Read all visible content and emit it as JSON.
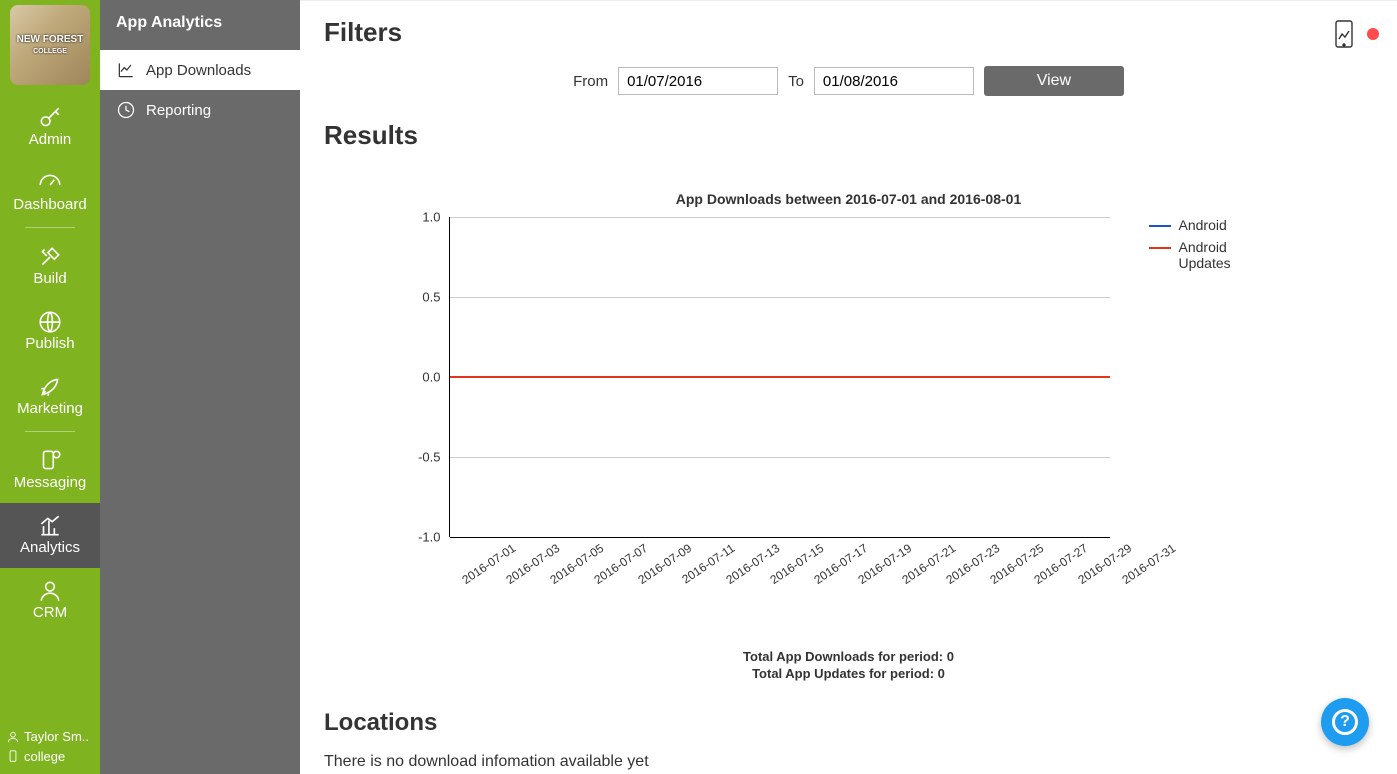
{
  "logo_text": "NEW FOREST",
  "logo_sub": "COLLEGE",
  "main_nav": {
    "items": [
      {
        "label": "Admin"
      },
      {
        "label": "Dashboard"
      },
      {
        "label": "Build"
      },
      {
        "label": "Publish"
      },
      {
        "label": "Marketing"
      },
      {
        "label": "Messaging"
      },
      {
        "label": "Analytics"
      },
      {
        "label": "CRM"
      }
    ]
  },
  "user_footer": {
    "name": "Taylor Sm..",
    "account": "college"
  },
  "sub_nav": {
    "title": "App Analytics",
    "items": [
      {
        "label": "App Downloads"
      },
      {
        "label": "Reporting"
      }
    ]
  },
  "filters": {
    "heading": "Filters",
    "from_label": "From",
    "from_value": "01/07/2016",
    "to_label": "To",
    "to_value": "01/08/2016",
    "view_label": "View"
  },
  "results": {
    "heading": "Results",
    "totals_downloads": "Total App Downloads for period: 0",
    "totals_updates": "Total App Updates for period: 0",
    "locations_heading": "Locations",
    "locations_empty": "There is no download infomation available yet"
  },
  "chart_data": {
    "type": "line",
    "title": "App Downloads between 2016-07-01 and 2016-08-01",
    "xlabel": "",
    "ylabel": "",
    "ylim": [
      -1.0,
      1.0
    ],
    "y_ticks": [
      "1.0",
      "0.5",
      "0.0",
      "-0.5",
      "-1.0"
    ],
    "categories": [
      "2016-07-01",
      "2016-07-03",
      "2016-07-05",
      "2016-07-07",
      "2016-07-09",
      "2016-07-11",
      "2016-07-13",
      "2016-07-15",
      "2016-07-17",
      "2016-07-19",
      "2016-07-21",
      "2016-07-23",
      "2016-07-25",
      "2016-07-27",
      "2016-07-29",
      "2016-07-31"
    ],
    "series": [
      {
        "name": "Android",
        "color": "#1f4fd6",
        "values": [
          0,
          0,
          0,
          0,
          0,
          0,
          0,
          0,
          0,
          0,
          0,
          0,
          0,
          0,
          0,
          0
        ]
      },
      {
        "name": "Android Updates",
        "color": "#e2341f",
        "values": [
          0,
          0,
          0,
          0,
          0,
          0,
          0,
          0,
          0,
          0,
          0,
          0,
          0,
          0,
          0,
          0
        ]
      }
    ]
  }
}
